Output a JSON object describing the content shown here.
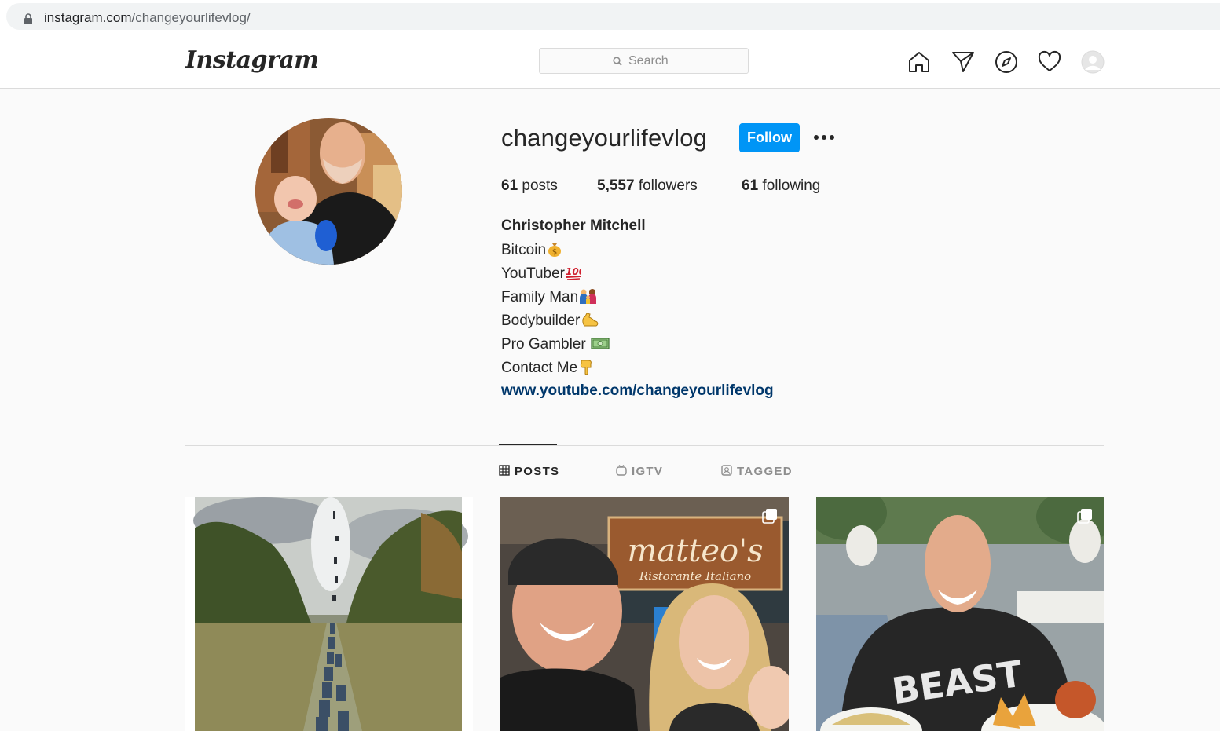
{
  "browser": {
    "url_domain": "instagram.com",
    "url_path": "/changeyourlifevlog/"
  },
  "header": {
    "logo_text": "Instagram",
    "search_placeholder": "Search",
    "nav_icons": [
      "home-icon",
      "direct-message-icon",
      "explore-icon",
      "activity-heart-icon",
      "profile-avatar-icon"
    ]
  },
  "profile": {
    "username": "changeyourlifevlog",
    "follow_label": "Follow",
    "more_icon": "more-options-icon",
    "stats": {
      "posts_count": "61",
      "posts_label": "posts",
      "followers_count": "5,557",
      "followers_label": "followers",
      "following_count": "61",
      "following_label": "following"
    },
    "full_name": "Christopher Mitchell",
    "bio_lines": [
      {
        "text": "Bitcoin",
        "emoji": "money-bag-icon"
      },
      {
        "text": "YouTuber",
        "emoji": "hundred-points-icon"
      },
      {
        "text": "Family Man",
        "emoji": "family-icon"
      },
      {
        "text": "Bodybuilder",
        "emoji": "flexed-biceps-icon"
      },
      {
        "text": "Pro Gambler ",
        "emoji": "dollar-banknote-icon"
      },
      {
        "text": "Contact Me",
        "emoji": "pointing-down-icon"
      }
    ],
    "website": "www.youtube.com/changeyourlifevlog"
  },
  "tabs": [
    {
      "label": "POSTS",
      "icon": "grid-icon",
      "active": true
    },
    {
      "label": "IGTV",
      "icon": "igtv-icon",
      "active": false
    },
    {
      "label": "TAGGED",
      "icon": "tagged-icon",
      "active": false
    }
  ],
  "posts": [
    {
      "alt": "field-people-ascending-photo",
      "multiple": false
    },
    {
      "alt": "matteos-restaurant-selfie-photo",
      "multiple": true,
      "sign_text": "matteo's",
      "sign_subtext": "Ristorante Italiano"
    },
    {
      "alt": "beast-shirt-dinner-photo",
      "multiple": true,
      "shirt_text": "BEAST"
    }
  ],
  "colors": {
    "accent": "#0095f6",
    "link": "#00376b",
    "border": "#dbdbdb",
    "background": "#fafafa"
  }
}
